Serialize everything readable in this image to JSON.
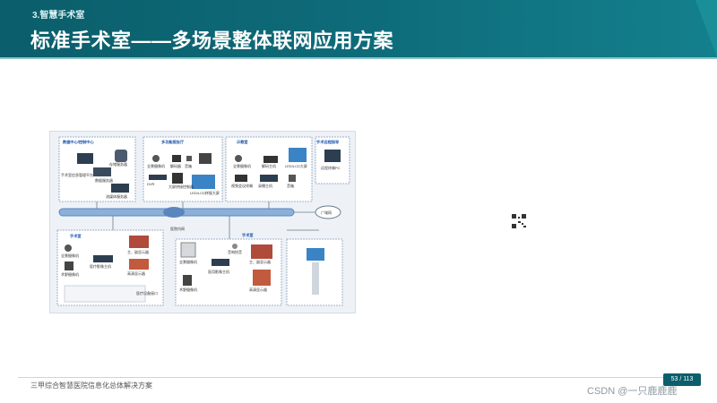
{
  "header": {
    "section_tag": "3.智慧手术室",
    "title": "标准手术室——多场景整体联网应用方案"
  },
  "footer": {
    "text": "三甲综合智慧医院信息化总体解决方案",
    "page": "53 / 113",
    "watermark": "CSDN @一只鹿鹿鹿"
  },
  "diagram": {
    "data_center": {
      "title": "数据中心/控制中心",
      "items": [
        "手术室信息管理平台",
        "数据服务器",
        "存储服务器",
        "流媒体服务器"
      ]
    },
    "lecture_hall": {
      "title": "多功能报告厅",
      "items": [
        "全景摄像机",
        "解码器",
        "音箱",
        "音箱",
        "DVR",
        "大屏拼接控制器",
        "LED/LCD拼接大屏",
        "远程会议"
      ]
    },
    "demo_room": {
      "title": "示教室",
      "items": [
        "全景摄像机",
        "解码主机",
        "LED/LCD大屏",
        "视频会议终端",
        "录播主机",
        "音箱",
        "麦克风"
      ]
    },
    "remote": {
      "title": "手术远程指导",
      "items": [
        "远程终端PC"
      ]
    },
    "network": {
      "internet": "广域网",
      "intranet": "医院内网"
    },
    "or_left": {
      "title": "手术室",
      "items": [
        "全景摄像机",
        "术野摄像机",
        "主、副显示器",
        "医疗影像主机",
        "高清显示器",
        "交换机",
        "医疗设备接口"
      ]
    },
    "or_right": {
      "title": "手术室",
      "items": [
        "全景摄像机",
        "主、副显示器",
        "医用影像主机",
        "术野摄像机",
        "高清显示器",
        "音响拾音"
      ]
    }
  }
}
